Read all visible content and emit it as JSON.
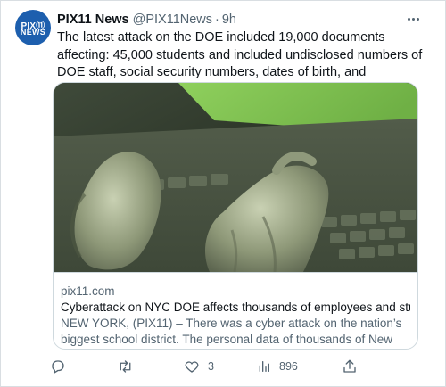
{
  "account": {
    "name": "PIX11 News",
    "handle": "@PIX11News",
    "separator": "·",
    "time": "9h",
    "avatar_top_text": "PIX⑪",
    "avatar_bottom_text": "NEWS",
    "avatar_color": "#1d5fae"
  },
  "tweet": {
    "text": "The latest attack on the DOE included 19,000 documents affecting: 45,000 students and included undisclosed numbers of DOE staff, social security numbers, dates of birth, and employee IDs."
  },
  "card": {
    "domain": "pix11.com",
    "title": "Cyberattack on NYC DOE affects thousands of employees and stude…",
    "description": "NEW YORK, (PIX11) – There was a cyber attack on the nation’s biggest school district. The personal data of thousands of New York City Publ…",
    "media": "hands typing on a laptop keyboard in green tinted light"
  },
  "actions": {
    "reply": {
      "icon": "reply-icon",
      "count": ""
    },
    "retweet": {
      "icon": "retweet-icon",
      "count": ""
    },
    "like": {
      "icon": "heart-icon",
      "count": "3"
    },
    "views": {
      "icon": "views-icon",
      "count": "896"
    },
    "share": {
      "icon": "share-icon",
      "count": ""
    }
  },
  "colors": {
    "text_primary": "#0f1419",
    "text_secondary": "#536471",
    "border": "#cfd9de"
  }
}
